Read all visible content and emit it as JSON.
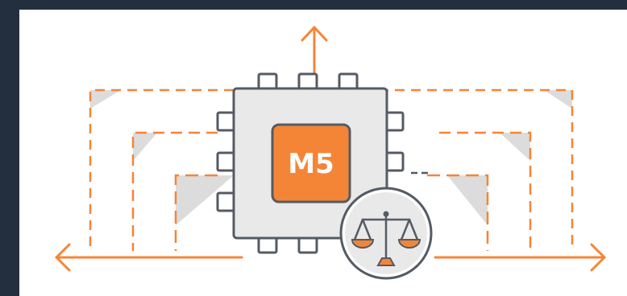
{
  "chip": {
    "label": "M5"
  },
  "icons": {
    "top_arrow": "arrow-up-icon",
    "left_arrow": "arrow-left-icon",
    "right_arrow": "arrow-right-icon",
    "balance": "balance-scale-icon"
  },
  "colors": {
    "frame": "#232f3e",
    "background": "#ffffff",
    "accent": "#f58536",
    "outline": "#545b64",
    "chip_fill": "#e9e9e9",
    "shadow": "#dcdcdc"
  }
}
